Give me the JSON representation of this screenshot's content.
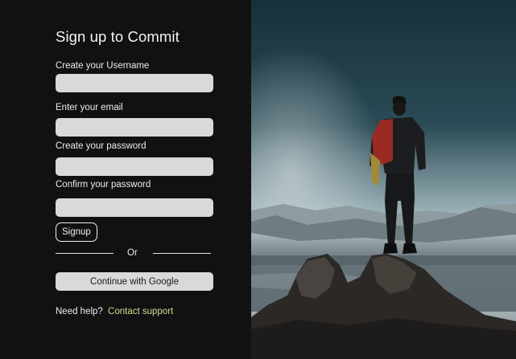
{
  "form": {
    "title": "Sign up to Commit",
    "username": {
      "label": "Create your Username",
      "value": ""
    },
    "email": {
      "label": "Enter your email",
      "value": ""
    },
    "password": {
      "label": "Create your password",
      "value": ""
    },
    "confirm": {
      "label": "Confirm your password",
      "value": ""
    },
    "signup_label": "Signup",
    "divider_text": "Or",
    "google_label": "Continue with Google",
    "help_text": "Need help?",
    "support_link": "Contact support"
  },
  "colors": {
    "panel_bg": "#111112",
    "input_bg": "#d9d9d9",
    "link": "#d9d98a"
  },
  "hero": {
    "icon": "hiker-on-mountain-photo"
  }
}
